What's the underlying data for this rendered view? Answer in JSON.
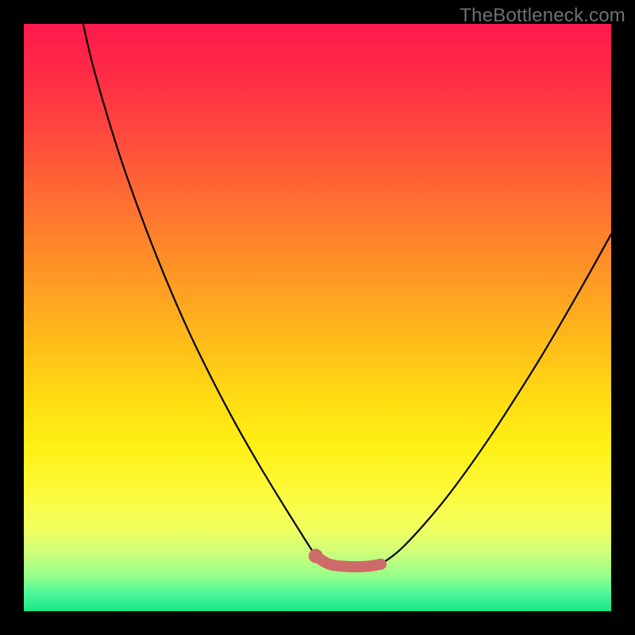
{
  "watermark": "TheBottleneck.com",
  "colors": {
    "frame": "#000000",
    "curve": "#000000",
    "highlight": "#cf6a6a",
    "highlight_dot": "#cf6a6a"
  },
  "chart_data": {
    "type": "line",
    "title": "",
    "xlabel": "",
    "ylabel": "",
    "xlim": [
      0,
      100
    ],
    "ylim": [
      0,
      100
    ],
    "grid": false,
    "legend": false,
    "series": [
      {
        "name": "left-branch",
        "x": [
          10.1,
          12,
          16,
          20,
          24,
          28,
          32,
          36,
          40,
          44,
          48,
          49.7
        ],
        "y": [
          100,
          92,
          78.6,
          67.2,
          57.0,
          47.8,
          39.6,
          32.0,
          25.0,
          18.4,
          12.0,
          9.4
        ]
      },
      {
        "name": "right-branch",
        "x": [
          60.8,
          64,
          68,
          72,
          76,
          80,
          84,
          88,
          92,
          96,
          100
        ],
        "y": [
          8.0,
          10.4,
          14.6,
          19.4,
          24.8,
          30.6,
          36.8,
          43.2,
          50.0,
          57.0,
          64.2
        ]
      },
      {
        "name": "valley-highlight",
        "x": [
          49.7,
          52,
          55,
          58,
          60.8
        ],
        "y": [
          9.4,
          8.0,
          7.6,
          7.6,
          8.0
        ]
      }
    ],
    "annotations": [
      {
        "name": "highlight-dot",
        "x": 49.7,
        "y": 9.4
      }
    ]
  }
}
